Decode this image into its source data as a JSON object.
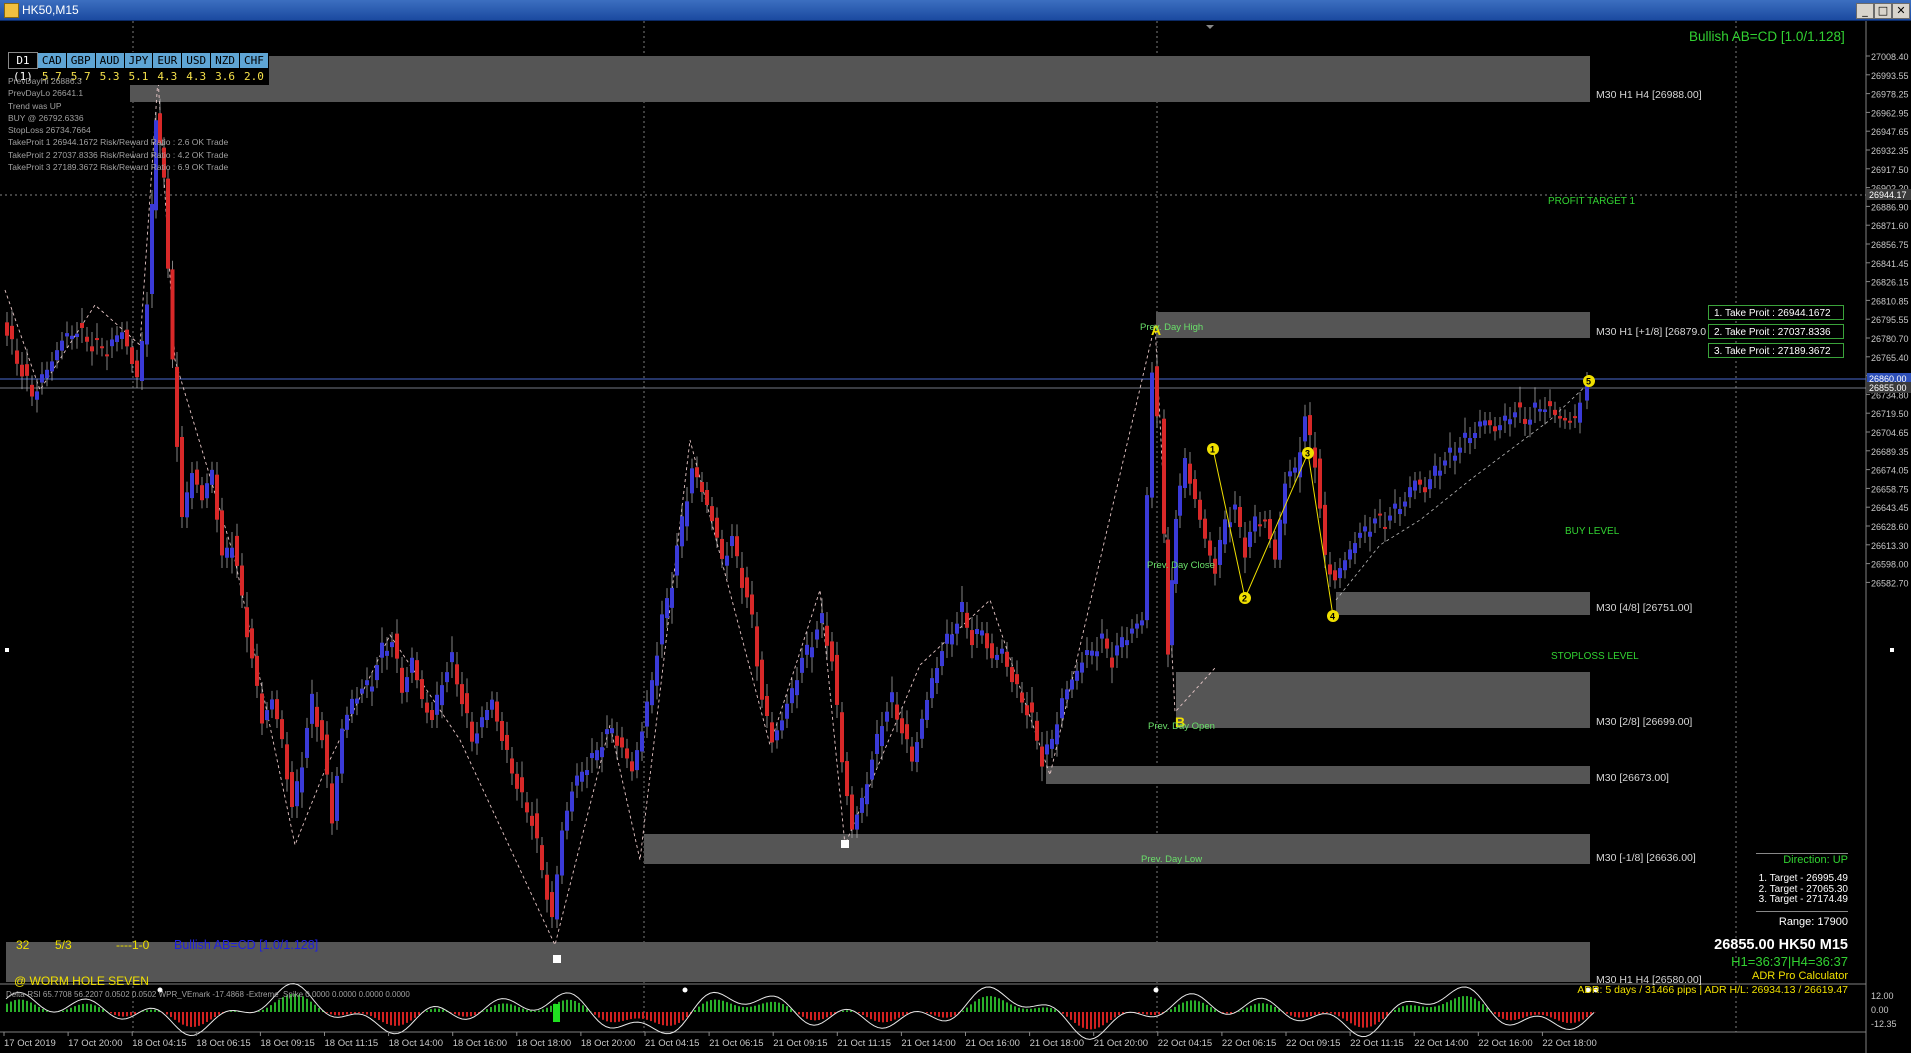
{
  "window": {
    "title": "HK50,M15",
    "minimize": "_",
    "restore": "□",
    "close": "✕"
  },
  "pattern_label_top": "Bullish AB=CD [1.0/1.128]",
  "currency_table": {
    "timeframe": "D1",
    "count": "(1)",
    "headers": [
      "CAD",
      "GBP",
      "AUD",
      "JPY",
      "EUR",
      "USD",
      "NZD",
      "CHF"
    ],
    "values": [
      "5.7",
      "5.7",
      "5.3",
      "5.1",
      "4.3",
      "4.3",
      "3.6",
      "2.0"
    ]
  },
  "info_lines": [
    "PrevDayHi 26886.3",
    "PrevDayLo 26641.1",
    "Trend was UP",
    "BUY @ 26792.6336",
    "StopLoss 26734.7664",
    "TakeProit 1 26944.1672 Risk/Reward Ratio : 2.6 OK Trade",
    "TakeProit 2 27037.8336 Risk/Reward Ratio : 4.2 OK Trade",
    "TakeProit 3 27189.3672 Risk/Reward Ratio : 6.9 OK Trade"
  ],
  "zones": [
    {
      "label": "M30 H1 H4  [26988.00]"
    },
    {
      "label": "M30 H1 [+1/8] [26879.0"
    },
    {
      "label": "M30 [4/8] [26751.00]"
    },
    {
      "label": "M30 [2/8] [26699.00]"
    },
    {
      "label": "M30  [26673.00]"
    },
    {
      "label": "M30 [-1/8] [26636.00]"
    },
    {
      "label": "M30 H1 H4  [26580.00]"
    }
  ],
  "level_labels": {
    "profit_target": "PROFIT TARGET 1",
    "buy_level": "BUY LEVEL",
    "stoploss_level": "STOPLOSS LEVEL",
    "prev_day_high": "Prev. Day High",
    "prev_day_close": "Prev. Day Close",
    "prev_day_open": "Prev. Day Open",
    "prev_day_low": "Prev. Day Low"
  },
  "take_profits": [
    "1. Take Proit : 26944.1672",
    "2. Take Proit : 27037.8336",
    "3. Take Proit : 27189.3672"
  ],
  "pattern_points": [
    "A",
    "B",
    "1",
    "2",
    "3",
    "4",
    "5"
  ],
  "price_axis": {
    "ticks": [
      "27008.40",
      "26993.55",
      "26978.25",
      "26962.95",
      "26947.65",
      "26932.35",
      "26917.50",
      "26902.20",
      "26886.90",
      "26871.60",
      "26856.75",
      "26841.45",
      "26826.15",
      "26810.85",
      "26795.55",
      "26780.70",
      "26765.40",
      "26750.10",
      "26734.80",
      "26719.50",
      "26704.65",
      "26689.35",
      "26674.05",
      "26658.75",
      "26643.45",
      "26628.60",
      "26613.30",
      "26598.00",
      "26582.70"
    ],
    "badges": [
      "26944.17",
      "26860.00",
      "26855.00"
    ],
    "sub_ticks": [
      "12.00",
      "0.00",
      "-12.35"
    ]
  },
  "right_panel": {
    "direction": "Direction: UP",
    "targets": [
      "1. Target - 26995.49",
      "2. Target - 27065.30",
      "3. Target - 27174.49"
    ],
    "range": "Range: 17900",
    "price_line": "26855.00 HK50 M15",
    "timer": "H1=36:37|H4=36:37",
    "adr_title": "ADR Pro Calculator",
    "adr_line": "ADR: 5 days / 31466 pips | ADR H/L: 26934.13 / 26619.47"
  },
  "bottom_left": {
    "n1": "32",
    "n2": "5/3",
    "n3": "----1-0",
    "pattern": "Bullish AB=CD [1.0/1.128]",
    "brand": "@ WORM HOLE SEVEN"
  },
  "subwindow": {
    "label": "Delta-RSI 65.7708 56.2207 0.0502 0.0502  WPR_VEmark -17.4868 -Extreme_Spike 0.0000 0.0000 0.0000 0.0000"
  },
  "time_axis": [
    "17 Oct 2019",
    "17 Oct 20:00",
    "18 Oct 04:15",
    "18 Oct 06:15",
    "18 Oct 09:15",
    "18 Oct 11:15",
    "18 Oct 14:00",
    "18 Oct 16:00",
    "18 Oct 18:00",
    "18 Oct 20:00",
    "21 Oct 04:15",
    "21 Oct 06:15",
    "21 Oct 09:15",
    "21 Oct 11:15",
    "21 Oct 14:00",
    "21 Oct 16:00",
    "21 Oct 18:00",
    "21 Oct 20:00",
    "22 Oct 04:15",
    "22 Oct 06:15",
    "22 Oct 09:15",
    "22 Oct 11:15",
    "22 Oct 14:00",
    "22 Oct 16:00",
    "22 Oct 18:00"
  ],
  "colors": {
    "bull": "#3a3ad8",
    "bear": "#d82828",
    "zone": "#555555",
    "green_text": "#32d232",
    "yellow": "#f0e000"
  }
}
